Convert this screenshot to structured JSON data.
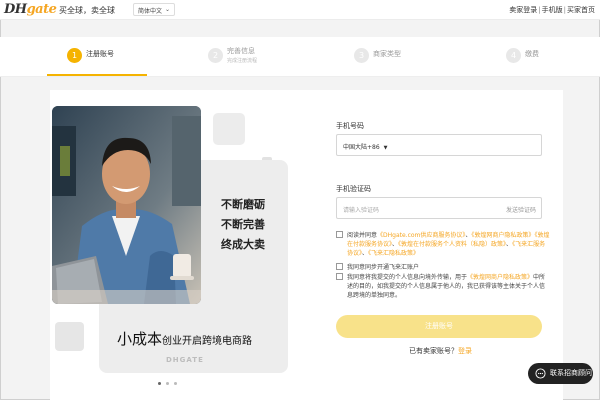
{
  "header": {
    "logo_dh": "DH",
    "logo_gate": "gate",
    "slogan": "买全球，卖全球",
    "language": "简体中文",
    "links": [
      "卖家登录",
      "手机版",
      "买家首页"
    ]
  },
  "steps": [
    {
      "num": "1",
      "label": "注册账号",
      "sub": ""
    },
    {
      "num": "2",
      "label": "完善信息",
      "sub": "完成注册流程"
    },
    {
      "num": "3",
      "label": "商家类型",
      "sub": ""
    },
    {
      "num": "4",
      "label": "缴费",
      "sub": ""
    }
  ],
  "promo": {
    "taglines": [
      "不断磨砺",
      "不断完善",
      "终成大卖"
    ],
    "slogan_big": "小成本",
    "slogan_small": "创业开启跨境电商路",
    "brand": "DHGATE"
  },
  "form": {
    "phone_label": "手机号码",
    "country_code": "中国大陆+86",
    "code_label": "手机验证码",
    "code_placeholder": "请输入验证码",
    "get_code": "发送验证码",
    "agreements": {
      "prefix": "阅读并同意",
      "items": [
        "《DHgate.com供应商服务协议》",
        "《敦煌网商户隐私政策》",
        "《敦煌在付款服务协议》",
        "《敦煌在付款服务个人资料（私隐）政策》",
        "《飞来汇服务协议》",
        "《飞来汇隐私政策》"
      ],
      "sep1": "、",
      "sep2": "、",
      "sep3": "、",
      "sep4": "、",
      "sep5": "、"
    },
    "feilaihui": "我同意同步开通飞来汇账户",
    "privacy_a": "我同意将我提交的个人信息向境外传输，用于",
    "privacy_link": "《敦煌网商户隐私政策》",
    "privacy_b": "中所述的目的，如我提交的个人信息属于他人的，我已获得该等主体关于个人信息跨境的单独同意。",
    "submit": "注册账号",
    "login_prompt": "已有卖家账号？",
    "login_link": "登录"
  },
  "contact": "联系招商顾问",
  "colors": {
    "accent": "#f5b301",
    "link": "#f5a623",
    "submit_disabled": "#f8e28a"
  }
}
